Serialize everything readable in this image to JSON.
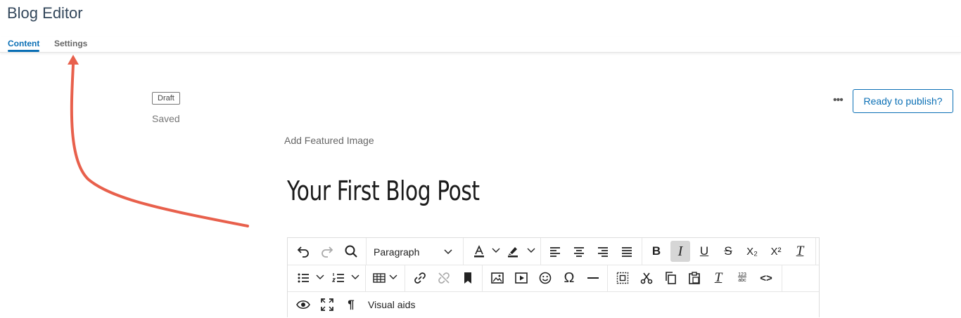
{
  "app": {
    "title": "Blog Editor"
  },
  "tabs": [
    {
      "label": "Content",
      "active": true
    },
    {
      "label": "Settings",
      "active": false
    }
  ],
  "status": {
    "badge": "Draft",
    "saved": "Saved"
  },
  "actions": {
    "more_label": "•••",
    "publish_label": "Ready to publish?"
  },
  "featured_image": {
    "label": "Add Featured Image"
  },
  "post": {
    "title": "Your First Blog Post"
  },
  "toolbar": {
    "block_format": "Paragraph",
    "visual_aids_label": "Visual aids",
    "glyphs": {
      "bold": "B",
      "italic": "I",
      "underline": "U",
      "strike": "S",
      "subscript": "X₂",
      "superscript": "X²",
      "clear": "T",
      "omega": "Ω",
      "pilcrow": "¶",
      "code": "<>",
      "spell_top": "123",
      "spell_bottom": "abc"
    }
  },
  "colors": {
    "accent": "#0a6fb5",
    "arrow": "#e8604c"
  }
}
